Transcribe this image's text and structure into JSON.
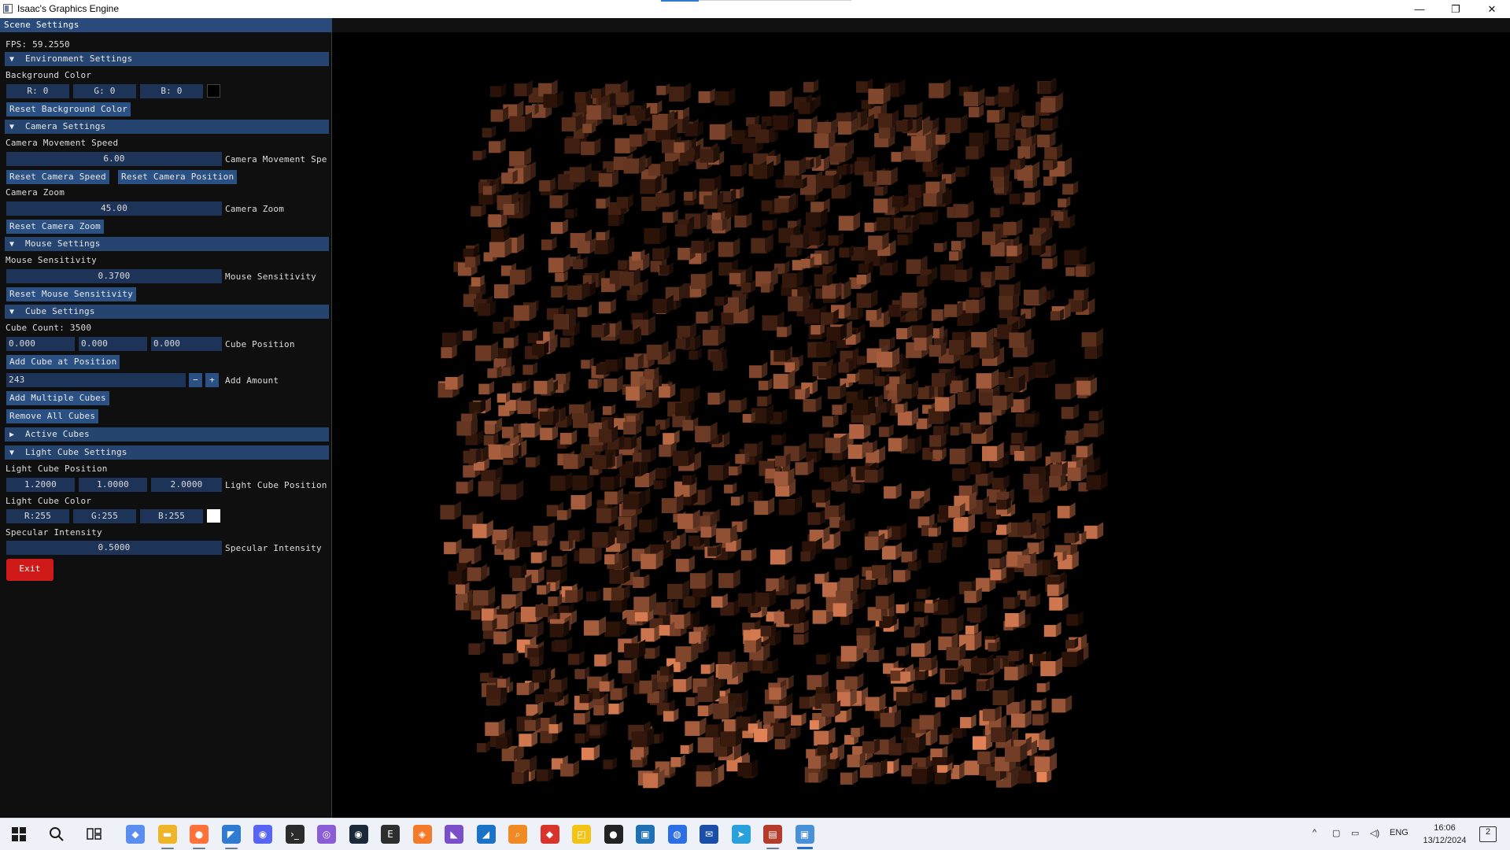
{
  "window": {
    "title": "Isaac's Graphics Engine",
    "controls": {
      "minimize": "—",
      "restore": "❐",
      "close": "✕"
    }
  },
  "panel": {
    "title": "Scene Settings",
    "fps": "FPS: 59.2550",
    "environment": {
      "header": "Environment Settings",
      "bg_label": "Background Color",
      "r": "R: 0",
      "g": "G: 0",
      "b": "B: 0",
      "swatch_color": "#000000",
      "reset_label": "Reset Background Color"
    },
    "camera": {
      "header": "Camera Settings",
      "speed_label": "Camera Movement Speed",
      "speed_value": "6.00",
      "speed_slider_label": "Camera Movement Spe",
      "reset_speed": "Reset Camera Speed",
      "reset_position": "Reset Camera Position",
      "zoom_label": "Camera Zoom",
      "zoom_value": "45.00",
      "zoom_slider_label": "Camera Zoom",
      "reset_zoom": "Reset Camera Zoom"
    },
    "mouse": {
      "header": "Mouse Settings",
      "sens_label": "Mouse Sensitivity",
      "sens_value": "0.3700",
      "sens_slider_label": "Mouse Sensitivity",
      "reset_sens": "Reset Mouse Sensitivity"
    },
    "cube": {
      "header": "Cube Settings",
      "count": "Cube Count: 3500",
      "pos_x": "0.000",
      "pos_y": "0.000",
      "pos_z": "0.000",
      "pos_label": "Cube Position",
      "add_at_position": "Add Cube at Position",
      "amount_value": "243",
      "minus": "−",
      "plus": "+",
      "amount_label": "Add Amount",
      "add_multiple": "Add Multiple Cubes",
      "remove_all": "Remove All Cubes"
    },
    "active_cubes": {
      "header": "Active Cubes"
    },
    "light": {
      "header": "Light Cube Settings",
      "pos_title": "Light Cube Position",
      "pos_x": "1.2000",
      "pos_y": "1.0000",
      "pos_z": "2.0000",
      "pos_label": "Light Cube Position",
      "color_title": "Light Cube Color",
      "r": "R:255",
      "g": "G:255",
      "b": "B:255",
      "swatch_color": "#ffffff",
      "spec_title": "Specular Intensity",
      "spec_value": "0.5000",
      "spec_label": "Specular Intensity"
    },
    "exit": "Exit"
  },
  "colors": {
    "panel_bg": "#0f0f0f",
    "header_bg": "#25446f",
    "button_bg": "#2a5084",
    "field_bg": "#1d3357",
    "exit_bg": "#d01a1a",
    "cube_light": "#f08a5c",
    "cube_dark": "#2a1208"
  },
  "taskbar": {
    "icons": [
      "windows-start-icon",
      "search-icon",
      "task-view-icon",
      "copilot-icon",
      "file-explorer-icon",
      "firefox-icon",
      "vscode-icon",
      "discord-icon",
      "terminal-icon",
      "github-desktop-icon",
      "steam-icon",
      "epic-games-icon",
      "blender-icon",
      "visual-studio-icon",
      "app-icon",
      "search-tool-icon",
      "git-icon",
      "folder-app-icon",
      "unity-icon",
      "paint-icon",
      "network-icon",
      "mail-icon",
      "telegram-icon",
      "winrar-icon",
      "graphics-engine-icon"
    ],
    "tray": {
      "language": "ENG",
      "time": "16:06",
      "date": "13/12/2024",
      "notifications": "2"
    }
  }
}
